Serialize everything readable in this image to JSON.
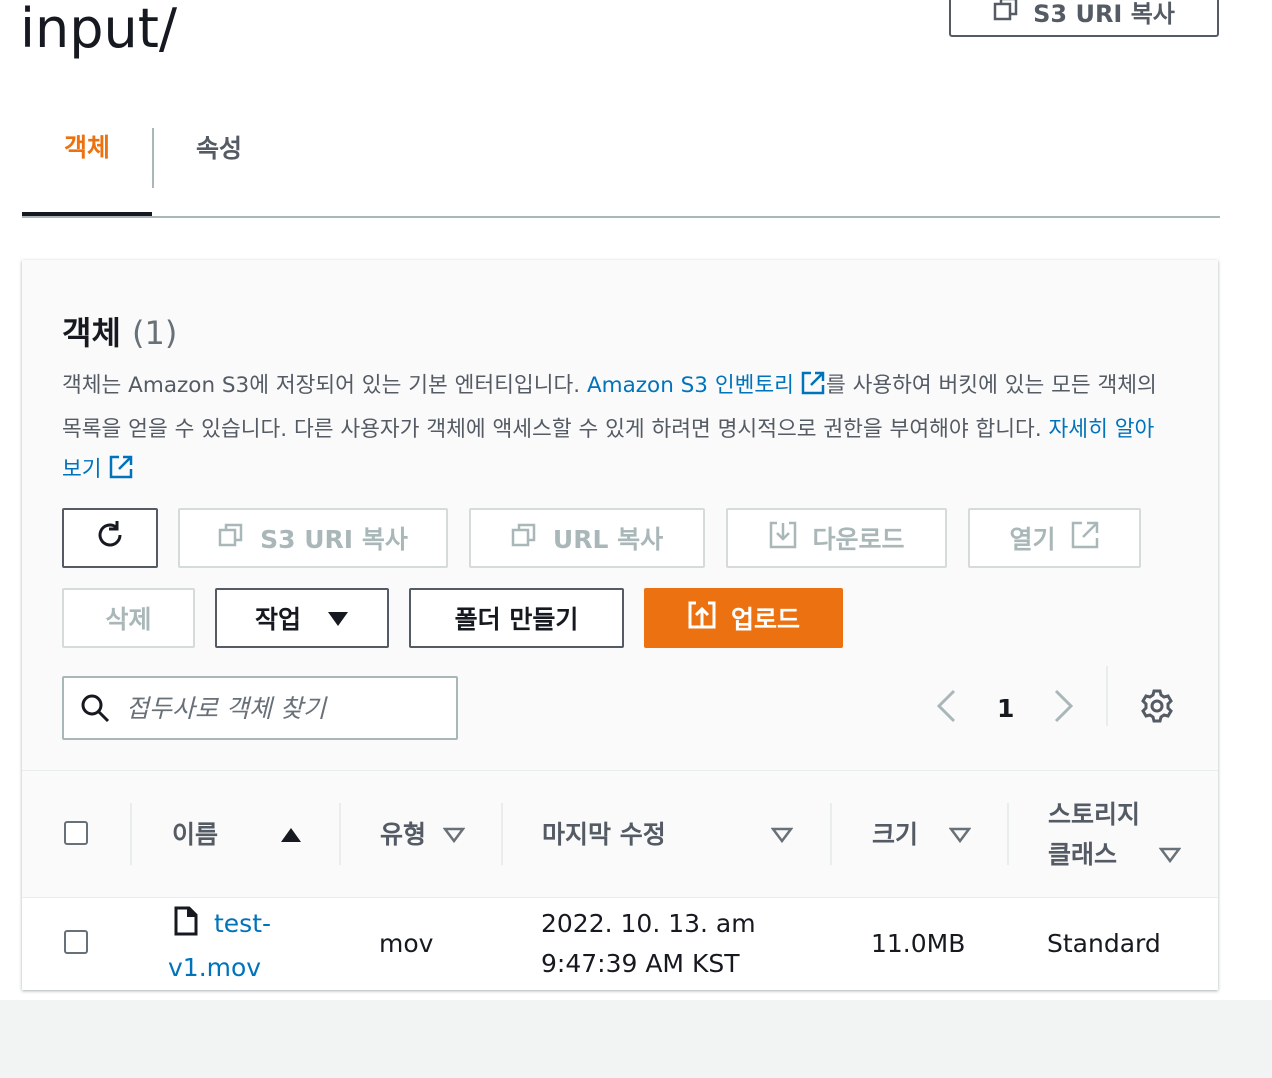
{
  "header": {
    "title": "input/",
    "copy_s3_uri_label": "S3 URI 복사"
  },
  "tabs": [
    {
      "label": "객체",
      "active": true
    },
    {
      "label": "속성",
      "active": false
    }
  ],
  "panel": {
    "heading": "객체",
    "count": "(1)",
    "description": {
      "part1": "객체는 Amazon S3에 저장되어 있는 기본 엔터티입니다. ",
      "link1": "Amazon S3 인벤토리",
      "part2": "를 사용하여 버킷에 있는 모든 객체의 목록을 얻을 수 있습니다. 다른 사용자가 객체에 액세스할 수 있게 하려면 명시적으로 권한을 부여해야 합니다. ",
      "link2": "자세히 알아보기"
    }
  },
  "actions": {
    "copy_s3_uri": "S3 URI 복사",
    "copy_url": "URL 복사",
    "download": "다운로드",
    "open": "열기",
    "delete": "삭제",
    "actions_menu": "작업",
    "create_folder": "폴더 만들기",
    "upload": "업로드"
  },
  "search": {
    "placeholder": "접두사로 객체 찾기"
  },
  "pagination": {
    "current_page": "1"
  },
  "table": {
    "columns": [
      "이름",
      "유형",
      "마지막 수정",
      "크기",
      "스토리지 클래스"
    ],
    "rows": [
      {
        "name": "test-v1.mov",
        "type": "mov",
        "last_modified": "2022. 10. 13. am 9:47:39 AM KST",
        "size": "11.0MB",
        "storage_class": "Standard"
      }
    ]
  },
  "colors": {
    "accent": "#ec7211",
    "link": "#0073bb",
    "text": "#16191f",
    "muted": "#545b64"
  }
}
